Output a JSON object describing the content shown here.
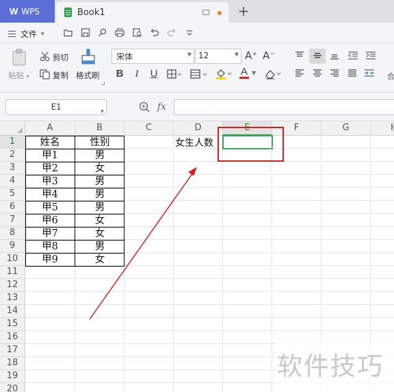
{
  "tabbar": {
    "app_label": "WPS",
    "app_logo": "W",
    "book_title": "Book1",
    "new_tab_label": "+"
  },
  "menu": {
    "file_label": "文件",
    "quick_icons": [
      "open-folder-icon",
      "save-icon",
      "search-doc-icon",
      "print-icon",
      "print-preview-icon",
      "undo-icon",
      "redo-icon",
      "more-icon"
    ]
  },
  "ribbon": {
    "paste_label": "粘贴",
    "cut_label": "剪切",
    "copy_label": "复制",
    "format_painter_label": "格式刷",
    "font_name": "宋体",
    "font_size": "12",
    "grow_font": "A⁺",
    "shrink_font": "A⁻",
    "bold": "B",
    "italic": "I",
    "underline": "U",
    "font_color_label": "A"
  },
  "formula_bar": {
    "cell_ref": "E1",
    "fx_label": "fx",
    "formula": ""
  },
  "grid": {
    "columns": [
      "A",
      "B",
      "C",
      "D",
      "E",
      "F",
      "G",
      "H"
    ],
    "active_column": "E",
    "rows": [
      "1",
      "2",
      "3",
      "4",
      "5",
      "6",
      "7",
      "8",
      "9",
      "10",
      "11",
      "12",
      "13",
      "14",
      "15",
      "16",
      "17",
      "18",
      "19",
      "20"
    ],
    "active_row": "1",
    "table": [
      [
        "姓名",
        "性别"
      ],
      [
        "甲1",
        "男"
      ],
      [
        "甲2",
        "女"
      ],
      [
        "甲3",
        "男"
      ],
      [
        "甲4",
        "男"
      ],
      [
        "甲5",
        "男"
      ],
      [
        "甲6",
        "女"
      ],
      [
        "甲7",
        "女"
      ],
      [
        "甲8",
        "男"
      ],
      [
        "甲9",
        "女"
      ]
    ],
    "d1": "女生人数"
  },
  "colors": {
    "wps_tab": "#5b6fd6",
    "selection": "#34a853",
    "annotation": "#d62020"
  },
  "watermark": "软件技巧"
}
